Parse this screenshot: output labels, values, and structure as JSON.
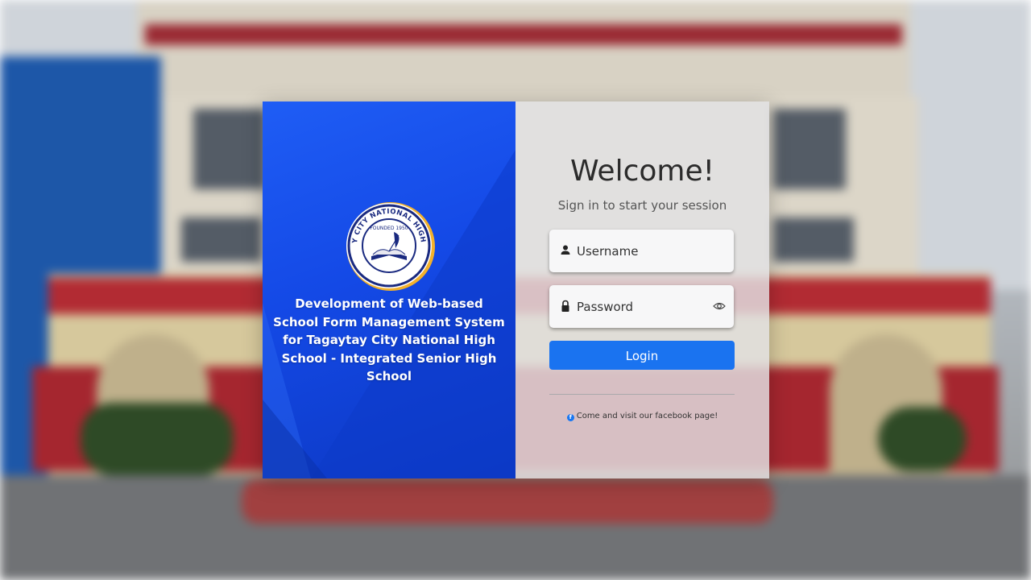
{
  "brand": {
    "logo_text": "TAGAYTAY CITY NATIONAL HIGH SCHOOL",
    "logo_founded": "FOUNDED 1950",
    "title": "Development of Web-based School Form Management System for Tagaytay City National High School - Integrated Senior High School"
  },
  "login": {
    "heading": "Welcome!",
    "subheading": "Sign in to start your session",
    "username_placeholder": "Username",
    "password_placeholder": "Password",
    "submit_label": "Login",
    "facebook_text": "Come and visit our facebook page!"
  },
  "icons": {
    "username": "user-icon",
    "password": "lock-icon",
    "toggle": "eye-icon",
    "facebook": "facebook-icon"
  },
  "colors": {
    "panel_blue": "#1449e6",
    "button_blue": "#1a73f0"
  }
}
